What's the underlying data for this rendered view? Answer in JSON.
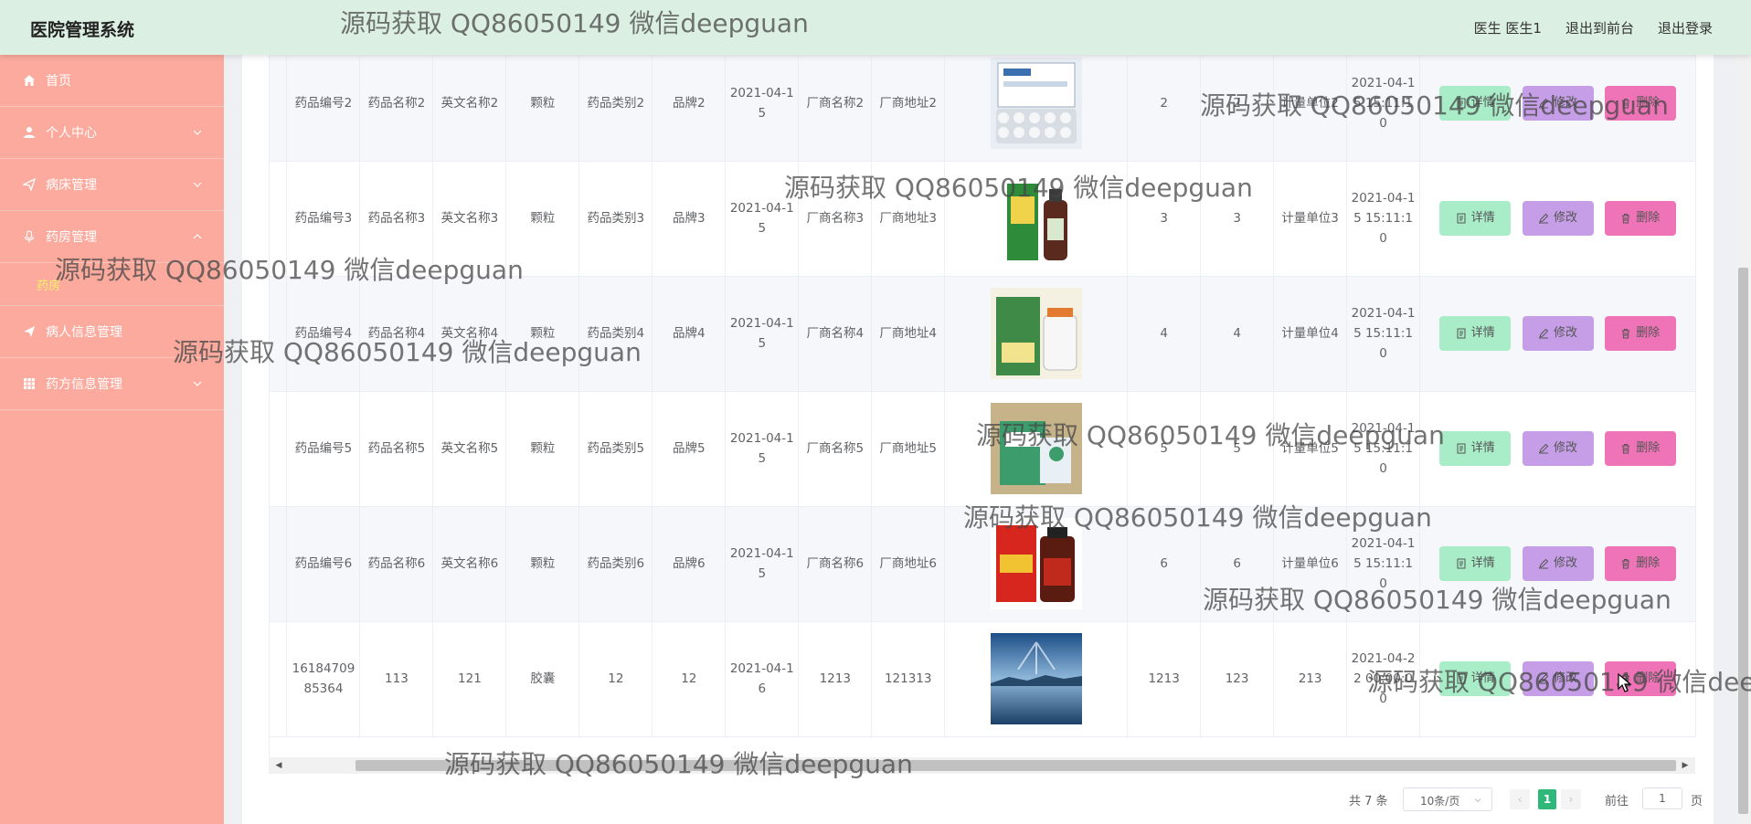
{
  "header": {
    "app_title": "医院管理系统",
    "user_label": "医生 医生1",
    "to_front_label": "退出到前台",
    "logout_label": "退出登录"
  },
  "sidebar": {
    "items": [
      {
        "label": "首页",
        "icon": "home-icon"
      },
      {
        "label": "个人中心",
        "icon": "user-icon"
      },
      {
        "label": "病床管理",
        "icon": "send-icon"
      },
      {
        "label": "药房管理",
        "icon": "mic-icon",
        "expanded": true,
        "children": [
          {
            "label": "药房"
          }
        ]
      },
      {
        "label": "病人信息管理",
        "icon": "send-icon"
      },
      {
        "label": "药方信息管理",
        "icon": "grid-icon"
      }
    ]
  },
  "table": {
    "rows": [
      {
        "code": "药品编号2",
        "name": "药品名称2",
        "en_name": "英文名称2",
        "form": "颗粒",
        "category": "药品类别2",
        "brand": "品牌2",
        "date": "2021-04-15",
        "maker": "厂商名称2",
        "address": "厂商地址2",
        "image": "medicine-box-icon",
        "c1": "2",
        "c2": "2",
        "unit": "计量单位2",
        "time": "2021-04-15 15:11:10"
      },
      {
        "code": "药品编号3",
        "name": "药品名称3",
        "en_name": "英文名称3",
        "form": "颗粒",
        "category": "药品类别3",
        "brand": "品牌3",
        "date": "2021-04-15",
        "maker": "厂商名称3",
        "address": "厂商地址3",
        "image": "medicine-bottle-icon",
        "c1": "3",
        "c2": "3",
        "unit": "计量单位3",
        "time": "2021-04-15 15:11:10"
      },
      {
        "code": "药品编号4",
        "name": "药品名称4",
        "en_name": "英文名称4",
        "form": "颗粒",
        "category": "药品类别4",
        "brand": "品牌4",
        "date": "2021-04-15",
        "maker": "厂商名称4",
        "address": "厂商地址4",
        "image": "medicine-jar-icon",
        "c1": "4",
        "c2": "4",
        "unit": "计量单位4",
        "time": "2021-04-15 15:11:10"
      },
      {
        "code": "药品编号5",
        "name": "药品名称5",
        "en_name": "英文名称5",
        "form": "颗粒",
        "category": "药品类别5",
        "brand": "品牌5",
        "date": "2021-04-15",
        "maker": "厂商名称5",
        "address": "厂商地址5",
        "image": "medicine-pack-icon",
        "c1": "5",
        "c2": "5",
        "unit": "计量单位5",
        "time": "2021-04-15 15:11:10"
      },
      {
        "code": "药品编号6",
        "name": "药品名称6",
        "en_name": "英文名称6",
        "form": "颗粒",
        "category": "药品类别6",
        "brand": "品牌6",
        "date": "2021-04-15",
        "maker": "厂商名称6",
        "address": "厂商地址6",
        "image": "medicine-vial-icon",
        "c1": "6",
        "c2": "6",
        "unit": "计量单位6",
        "time": "2021-04-15 15:11:10"
      },
      {
        "code": "1618470985364",
        "name": "113",
        "en_name": "121",
        "form": "胶囊",
        "category": "12",
        "brand": "12",
        "date": "2021-04-16",
        "maker": "1213",
        "address": "121313",
        "image": "landscape-photo",
        "c1": "1213",
        "c2": "123",
        "unit": "213",
        "time": "2021-04-22 00:00:00"
      }
    ],
    "actions": {
      "detail_label": "详情",
      "edit_label": "修改",
      "delete_label": "删除"
    }
  },
  "pagination": {
    "total_label": "共 7 条",
    "page_size": "10条/页",
    "current_page": "1",
    "goto_label": "前往",
    "goto_value": "1",
    "page_suffix": "页"
  },
  "watermark": {
    "text": "源码获取 QQ86050149 微信deepguan"
  },
  "colors": {
    "header_bg": "#dcefe3",
    "sidebar_bg": "#fbaa9d",
    "detail_btn": "#a8ecc8",
    "edit_btn": "#c69ee7",
    "delete_btn": "#ee74b7",
    "pager_active": "#30b77a"
  }
}
